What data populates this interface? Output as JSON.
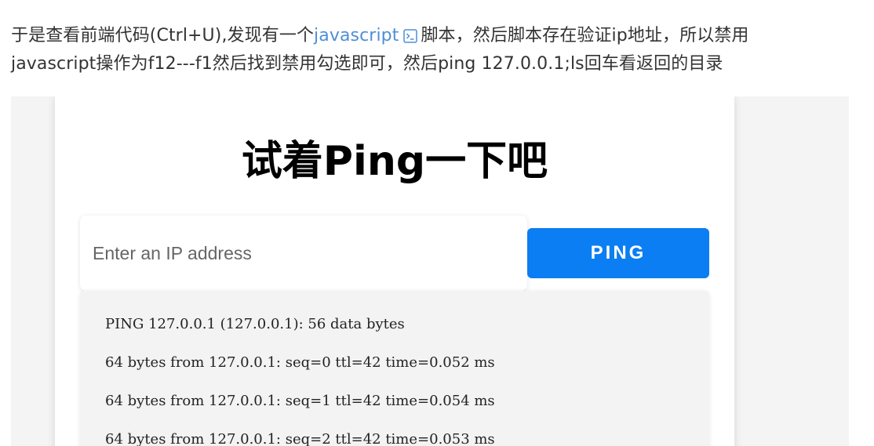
{
  "article": {
    "line1_before": "于是查看前端代码(Ctrl+U),发现有一个",
    "link_text": "javascript",
    "line1_after": "脚本，然后脚本存在验证ip地址，所以禁用",
    "line2": "javascript操作为f12---f1然后找到禁用勾选即可，然后ping 127.0.0.1;ls回车看返回的目录",
    "link_icon": "external-link-icon"
  },
  "screenshot": {
    "title": "试着Ping一下吧",
    "input_placeholder": "Enter an IP address",
    "input_value": "",
    "button_label": "PING",
    "accent_color": "#0a7ef2",
    "output_lines": [
      "PING 127.0.0.1 (127.0.0.1): 56 data bytes",
      "64 bytes from 127.0.0.1: seq=0 ttl=42 time=0.052 ms",
      "64 bytes from 127.0.0.1: seq=1 ttl=42 time=0.054 ms",
      "64 bytes from 127.0.0.1: seq=2 ttl=42 time=0.053 ms"
    ]
  }
}
